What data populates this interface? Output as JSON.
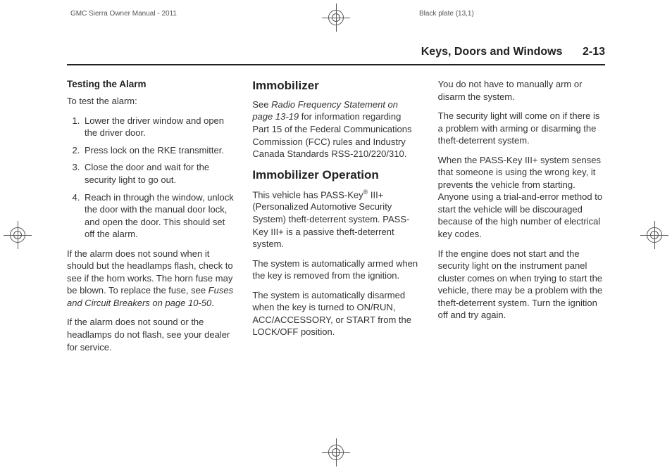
{
  "meta": {
    "manual": "GMC Sierra Owner Manual - 2011",
    "plate": "Black plate (13,1)"
  },
  "header": {
    "chapter": "Keys, Doors and Windows",
    "page": "2-13"
  },
  "col1": {
    "h_testing": "Testing the Alarm",
    "intro": "To test the alarm:",
    "step1": "Lower the driver window and open the driver door.",
    "step2": "Press lock on the RKE transmitter.",
    "step3": "Close the door and wait for the security light to go out.",
    "step4": "Reach in through the window, unlock the door with the manual door lock, and open the door. This should set off the alarm.",
    "p_nosound1a": "If the alarm does not sound when it should but the headlamps flash, check to see if the horn works. The horn fuse may be blown. To replace the fuse, see ",
    "p_nosound1_ref": "Fuses and Circuit Breakers on page 10‑50",
    "p_nosound1b": ".",
    "p_nosound2": "If the alarm does not sound or the headlamps do not flash, see your dealer for service."
  },
  "col2": {
    "h_immobilizer": "Immobilizer",
    "p_immobilizer_a": "See ",
    "p_immobilizer_ref": "Radio Frequency Statement on page 13‑19",
    "p_immobilizer_b": " for information regarding Part 15 of the Federal Communications Commission (FCC) rules and Industry Canada Standards RSS-210/220/310.",
    "h_operation": "Immobilizer Operation",
    "p_op1a": "This vehicle has PASS-Key",
    "p_op1_sup": "®",
    "p_op1b": " III+ (Personalized Automotive Security System) theft-deterrent system. PASS-Key III+ is a passive theft-deterrent system.",
    "p_op2": "The system is automatically armed when the key is removed from the ignition.",
    "p_op3": "The system is automatically disarmed when the key is turned to ON/RUN, ACC/ACCESSORY, or START from the LOCK/OFF position."
  },
  "col3": {
    "p1": "You do not have to manually arm or disarm the system.",
    "p2": "The security light will come on if there is a problem with arming or disarming the theft-deterrent system.",
    "p3": "When the PASS-Key III+ system senses that someone is using the wrong key, it prevents the vehicle from starting. Anyone using a trial-and-error method to start the vehicle will be discouraged because of the high number of electrical key codes.",
    "p4": "If the engine does not start and the security light on the instrument panel cluster comes on when trying to start the vehicle, there may be a problem with the theft-deterrent system. Turn the ignition off and try again."
  }
}
